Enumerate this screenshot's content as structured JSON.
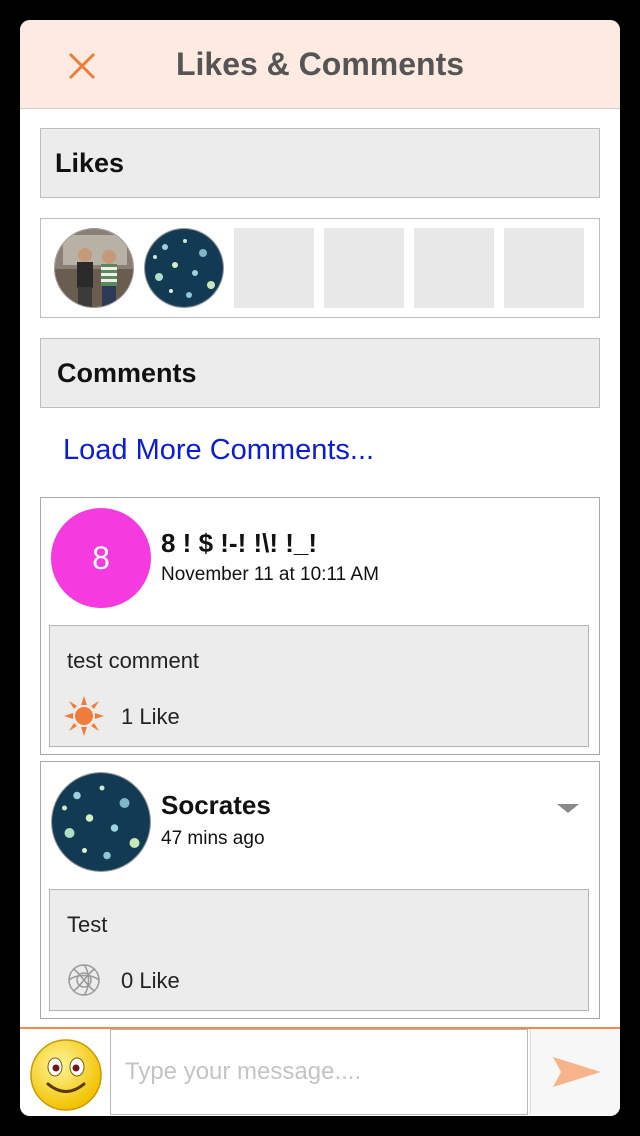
{
  "header": {
    "title": "Likes & Comments",
    "close_icon": "close-icon",
    "accent": "#f07c3a"
  },
  "likes_section": {
    "title": "Likes"
  },
  "comments_section": {
    "title": "Comments"
  },
  "load_more": "Load More Comments...",
  "comments": [
    {
      "initial": "8",
      "author": "8 ! $ !-! !\\! !_!",
      "time": "November 11 at 10:11 AM",
      "text": "test comment",
      "likes": "1 Like",
      "avatar_color": "#f53ae0",
      "liked": true
    },
    {
      "author": "Socrates",
      "time": "47 mins ago",
      "text": "Test",
      "likes": "0 Like",
      "liked": false
    }
  ],
  "composer": {
    "placeholder": "Type your message....",
    "send_icon": "send-icon",
    "emoji_icon": "smiley-emoji-icon"
  }
}
